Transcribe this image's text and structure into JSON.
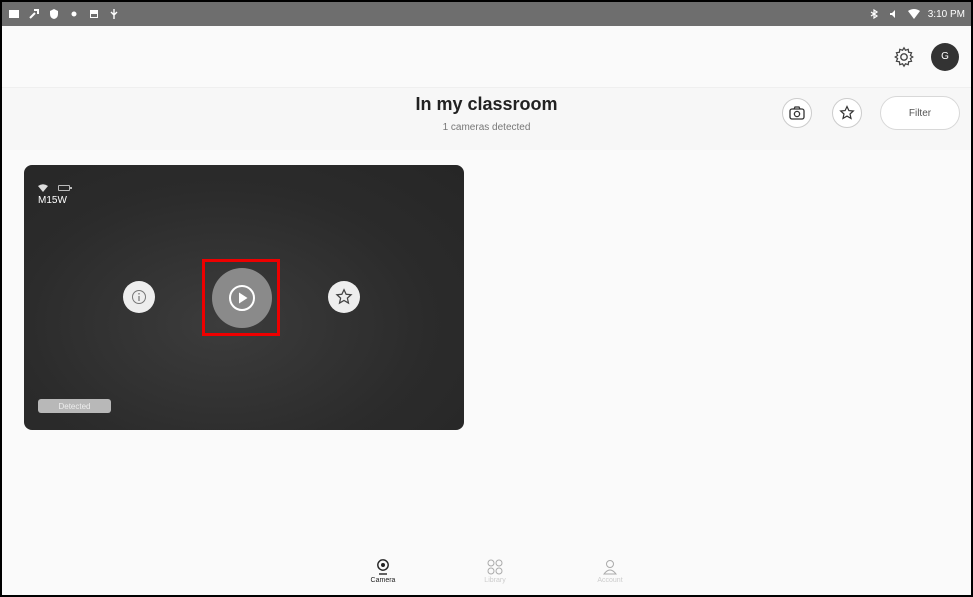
{
  "status_bar": {
    "time": "3:10 PM"
  },
  "header": {
    "title": "In my classroom",
    "subtitle": "1 cameras detected",
    "filter_label": "Filter"
  },
  "account": {
    "avatar_initial": "G"
  },
  "camera_card": {
    "name": "M15W",
    "status_badge": "Detected"
  },
  "bottom_nav": {
    "items": [
      {
        "label": "Camera",
        "icon": "camera-icon",
        "active": true
      },
      {
        "label": "Library",
        "icon": "grid-icon",
        "active": false
      },
      {
        "label": "Account",
        "icon": "person-icon",
        "active": false
      }
    ]
  },
  "colors": {
    "highlight": "#e00000",
    "card_bg": "#2b2b2b",
    "status_bar": "#6e6e6e"
  }
}
